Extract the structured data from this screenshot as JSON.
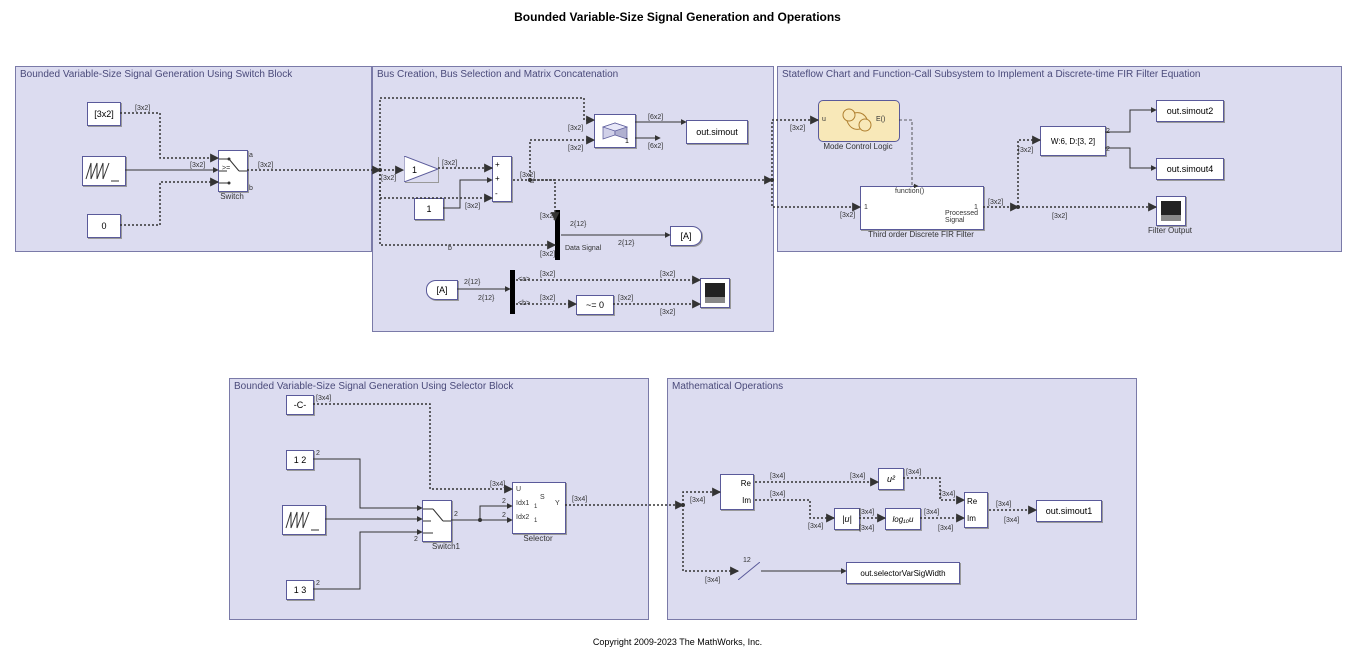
{
  "title": "Bounded Variable-Size Signal Generation and Operations",
  "copyright": "Copyright 2009-2023 The MathWorks, Inc.",
  "regions": {
    "r1": "Bounded Variable-Size Signal Generation Using Switch Block",
    "r2": "Bus Creation, Bus Selection and Matrix Concatenation",
    "r3": "Stateflow Chart and Function-Call Subsystem to Implement a Discrete-time FIR Filter Equation",
    "r4": "Bounded Variable-Size Signal Generation Using Selector Block",
    "r5": "Mathematical Operations"
  },
  "blocks": {
    "const1": "[3x2]",
    "const0": "0",
    "switch1": "Switch",
    "switch1_op": ">=",
    "gain1": "1",
    "const1b": "1",
    "sum_port_a": "+",
    "sum_port_b": "+",
    "sum_port_c": "-",
    "concat_n": "1",
    "outsimout": "out.simout",
    "busname": "Data Signal",
    "gotoA": "[A]",
    "fromA": "[A]",
    "neq0": "~= 0",
    "sel_a": "<a>",
    "sel_b": "<b>",
    "mode_u": "u",
    "mode_e": "E()",
    "mode_label": "Mode Control Logic",
    "fcn": "function()",
    "fcn_in": "1",
    "fcn_out": "1",
    "fcn_outname": "Processed\nSignal",
    "fir_label": "Third order Discrete FIR Filter",
    "delay": "W:6, D:[3, 2]",
    "delay_ports": "2",
    "outsimout2": "out.simout2",
    "outsimout4": "out.simout4",
    "filterout": "Filter Output",
    "constC": "-C-",
    "const12": "1  2",
    "const13": "1  3",
    "switch2": "Switch1",
    "sel_U": "U",
    "sel_I1": "Idx1",
    "sel_I2": "Idx2",
    "sel_S": "S",
    "sel_1a": "1",
    "sel_1b": "1",
    "sel_Y": "Y",
    "selector": "Selector",
    "re": "Re",
    "im": "Im",
    "abs": "|u|",
    "sq": "u²",
    "log10": "log₁₀u",
    "re2": "Re",
    "im2": "Im",
    "outsimout1": "out.simout1",
    "width12": "12",
    "outselwidth": "out.selectorVarSigWidth"
  },
  "dims": {
    "d3x2": "[3x2]",
    "d6x2": "[6x2]",
    "d3x4": "[3x4]",
    "d212": "2{12}",
    "d2": "2",
    "d12": "12"
  },
  "busport": {
    "a": "a",
    "b": "b"
  }
}
